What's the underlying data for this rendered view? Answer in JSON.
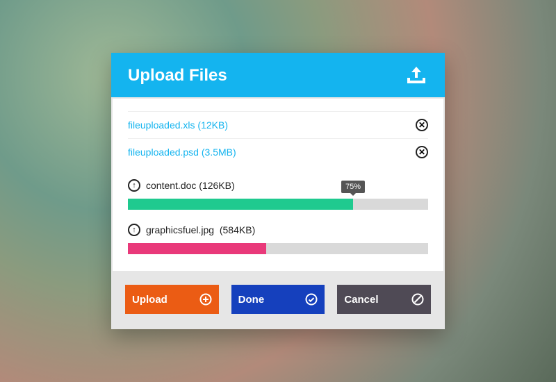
{
  "header": {
    "title": "Upload Files"
  },
  "completed": [
    {
      "name": "fileuploaded.xls",
      "size": "12KB"
    },
    {
      "name": "fileuploaded.psd",
      "size": "3.5MB"
    }
  ],
  "inprogress": [
    {
      "name": "content.doc",
      "size": "126KB",
      "percent": 75,
      "show_tooltip": true,
      "color": "#1fca8f"
    },
    {
      "name": "graphicsfuel.jpg",
      "size": "584KB",
      "percent": 46,
      "show_tooltip": false,
      "color": "#e9397a"
    }
  ],
  "buttons": {
    "upload": "Upload",
    "done": "Done",
    "cancel": "Cancel"
  }
}
